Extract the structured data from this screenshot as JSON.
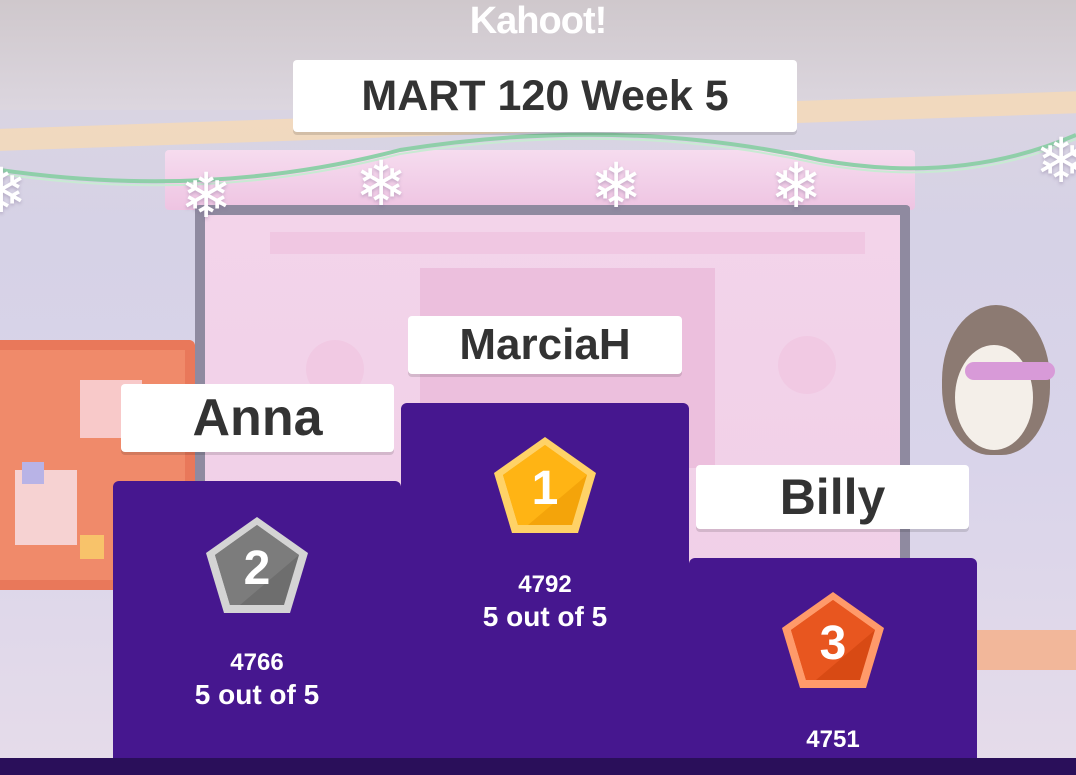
{
  "brand": {
    "logo_text": "Kahoot!"
  },
  "quiz": {
    "title": "MART 120 Week 5"
  },
  "colors": {
    "podium": "#46178f",
    "gold": "#ffb10a",
    "silver": "#7b7b7b",
    "bronze": "#e8561f"
  },
  "podium": [
    {
      "rank": "2",
      "name": "Anna",
      "score": "4766",
      "result": "5 out of 5",
      "medal_icon": "silver-medal-icon"
    },
    {
      "rank": "1",
      "name": "MarciaH",
      "score": "4792",
      "result": "5 out of 5",
      "medal_icon": "gold-medal-icon"
    },
    {
      "rank": "3",
      "name": "Billy",
      "score": "4751",
      "medal_icon": "bronze-medal-icon"
    }
  ]
}
